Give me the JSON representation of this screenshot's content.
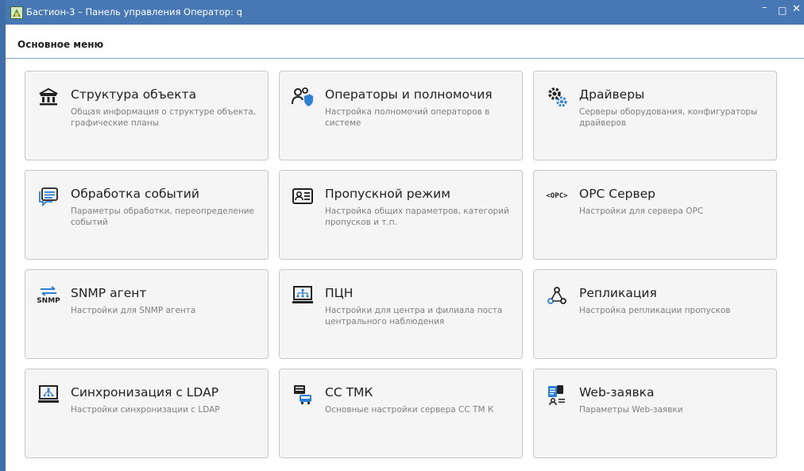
{
  "window": {
    "title": "Бастион-3 – Панель управления Оператор: q",
    "minimize": "–",
    "maximize": "□",
    "close": "✕"
  },
  "menu": {
    "title": "Основное меню"
  },
  "tiles": [
    {
      "title": "Структура объекта",
      "desc": "Общая информация о структуре объекта, графические планы",
      "icon": "building-icon"
    },
    {
      "title": "Операторы и полномочия",
      "desc": "Настройка полномочий операторов в системе",
      "icon": "operators-shield-icon"
    },
    {
      "title": "Драйверы",
      "desc": "Серверы оборудования, конфигураторы драйверов",
      "icon": "gears-icon"
    },
    {
      "title": "Обработка событий",
      "desc": "Параметры обработки, переопределение событий",
      "icon": "message-list-icon"
    },
    {
      "title": "Пропускной режим",
      "desc": "Настройка общих параметров, категорий пропусков и т.п.",
      "icon": "id-card-icon"
    },
    {
      "title": "OPC Сервер",
      "desc": "Настройки для сервера OPC",
      "icon": "opc-icon",
      "icon_text": "<OPC>"
    },
    {
      "title": "SNMP агент",
      "desc": "Настройки для SNMP агента",
      "icon": "snmp-icon",
      "icon_text": "SNMP"
    },
    {
      "title": "ПЦН",
      "desc": "Настройки для центра и филиала поста центрального наблюдения",
      "icon": "monitor-network-icon"
    },
    {
      "title": "Репликация",
      "desc": "Настройка репликации пропусков",
      "icon": "replication-icon"
    },
    {
      "title": "Синхронизация с LDAP",
      "desc": "Настройки синхронизации с LDAP",
      "icon": "ldap-monitor-icon"
    },
    {
      "title": "СС ТМК",
      "desc": "Основные настройки сервера СС ТМ К",
      "icon": "bus-server-icon"
    },
    {
      "title": "Web-заявка",
      "desc": "Параметры Web-заявки",
      "icon": "web-request-icon"
    }
  ]
}
